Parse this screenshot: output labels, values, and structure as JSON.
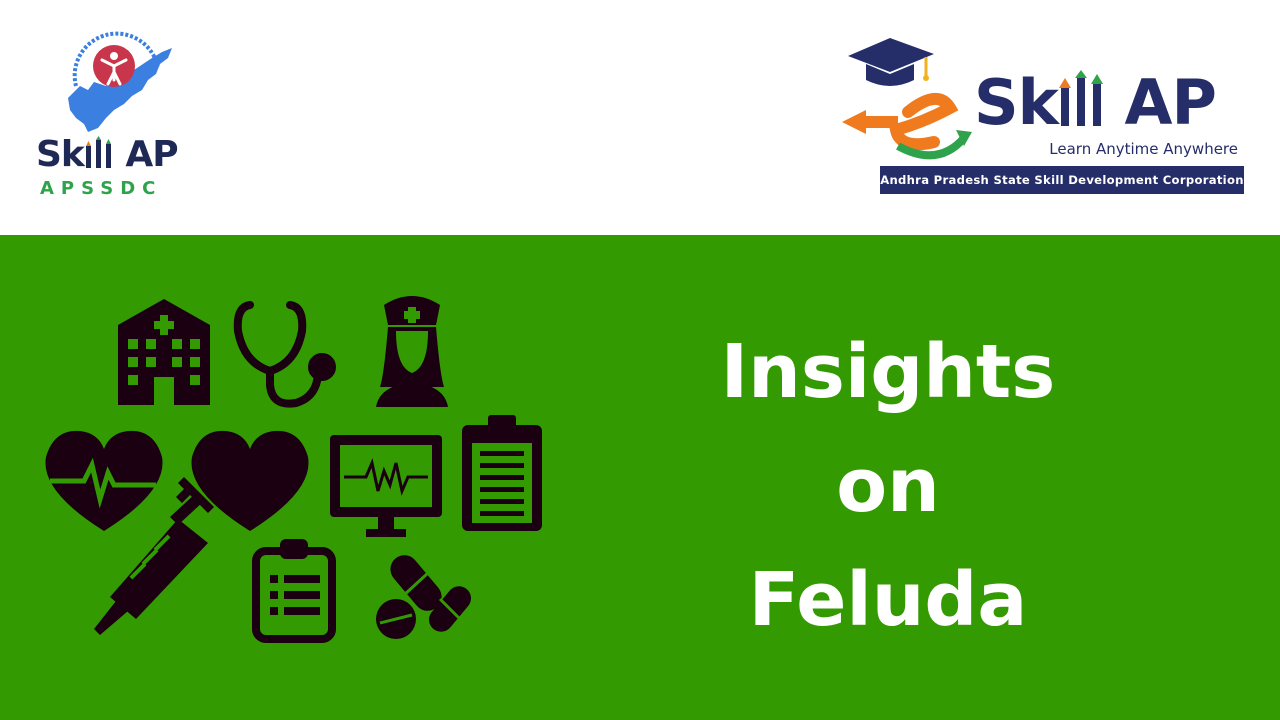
{
  "header": {
    "left_logo": {
      "brand": "Skill AP",
      "brand_prefix": "Sk",
      "brand_suffix": "AP",
      "subtitle": "APSSDC",
      "map_color": "#3b7fe0",
      "circle_color": "#c9354a"
    },
    "right_logo": {
      "brand_e": "e",
      "brand_prefix": "Sk",
      "brand_suffix": "AP",
      "tagline": "Learn Anytime Anywhere",
      "strip": "Andhra Pradesh State Skill Development Corporation",
      "brand_color": "#262e6a",
      "e_color": "#f07b1e",
      "arrow_color": "#2fa34b"
    }
  },
  "banner": {
    "background": "#339a02",
    "icon_color": "#1a0010",
    "title_lines": [
      "Insights",
      "on",
      "Feluda"
    ],
    "icons": [
      "hospital-icon",
      "stethoscope-icon",
      "nurse-icon",
      "heartbeat-icon",
      "heart-icon",
      "monitor-icon",
      "clipboard-icon",
      "syringe-icon",
      "checklist-icon",
      "pills-icon"
    ]
  }
}
